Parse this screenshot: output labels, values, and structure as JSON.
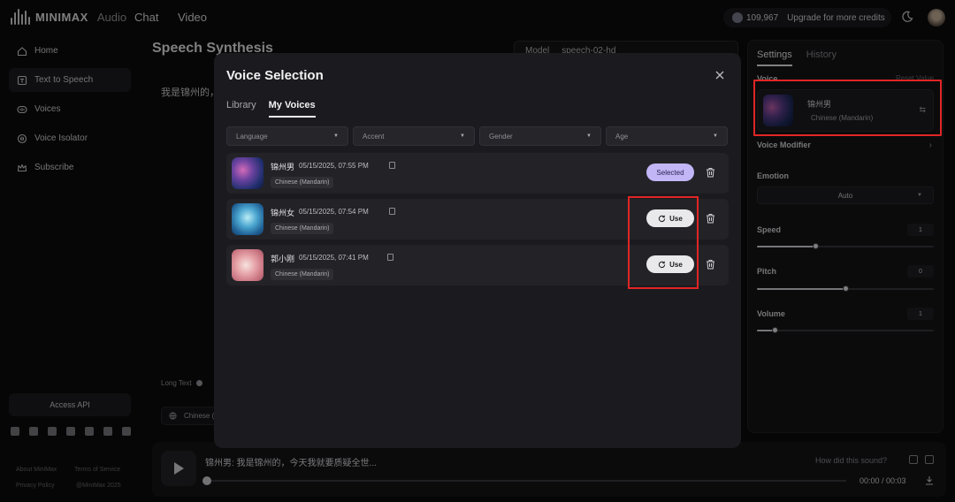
{
  "topbar": {
    "brand": "MINIMAX",
    "brand_sub": "Audio",
    "nav": [
      "Chat",
      "Video"
    ],
    "credits": "109,967",
    "upgrade": "Upgrade for more credits"
  },
  "sidebar": {
    "items": [
      {
        "label": "Home",
        "icon": "home-icon"
      },
      {
        "label": "Text to Speech",
        "icon": "tts-icon",
        "active": true
      },
      {
        "label": "Voices",
        "icon": "voices-icon"
      },
      {
        "label": "Voice Isolator",
        "icon": "isolator-icon"
      },
      {
        "label": "Subscribe",
        "icon": "crown-icon"
      }
    ],
    "access_api": "Access API",
    "footer": {
      "about": "About MiniMax",
      "terms": "Terms of Service",
      "privacy": "Privacy Policy",
      "copyright": "@MiniMax 2025"
    }
  },
  "main": {
    "title": "Speech Synthesis",
    "model_label": "Model",
    "model_value": "speech-02-hd",
    "editor_text": "我是锦州的，",
    "long_text": "Long Text",
    "lang_chip": "Chinese ("
  },
  "player": {
    "title": "锦州男: 我是锦州的，今天我就要质疑全世...",
    "question": "How did this sound?",
    "time": "00:00 / 00:03",
    "progress": 0
  },
  "settings": {
    "tabs": [
      "Settings",
      "History"
    ],
    "voice_label": "Voice",
    "reset": "Reset Value",
    "voice_name": "锦州男",
    "voice_lang": "Chinese (Mandarin)",
    "modifier_label": "Voice Modifier",
    "emotion_label": "Emotion",
    "emotion_value": "Auto",
    "speed_label": "Speed",
    "speed_value": "1",
    "speed_fraction": 0.33,
    "pitch_label": "Pitch",
    "pitch_value": "0",
    "pitch_fraction": 0.5,
    "volume_label": "Volume",
    "volume_value": "1",
    "volume_fraction": 0.1
  },
  "modal": {
    "title": "Voice Selection",
    "tabs": [
      "Library",
      "My Voices"
    ],
    "filters": [
      "Language",
      "Accent",
      "Gender",
      "Age"
    ],
    "voices": [
      {
        "name": "锦州男",
        "date": "05/15/2025, 07:55 PM",
        "lang": "Chinese (Mandarin)",
        "action": "Selected"
      },
      {
        "name": "锦州女",
        "date": "05/15/2025, 07:54 PM",
        "lang": "Chinese (Mandarin)",
        "action": "Use"
      },
      {
        "name": "郭小刚",
        "date": "05/15/2025, 07:41 PM",
        "lang": "Chinese (Mandarin)",
        "action": "Use"
      }
    ]
  }
}
